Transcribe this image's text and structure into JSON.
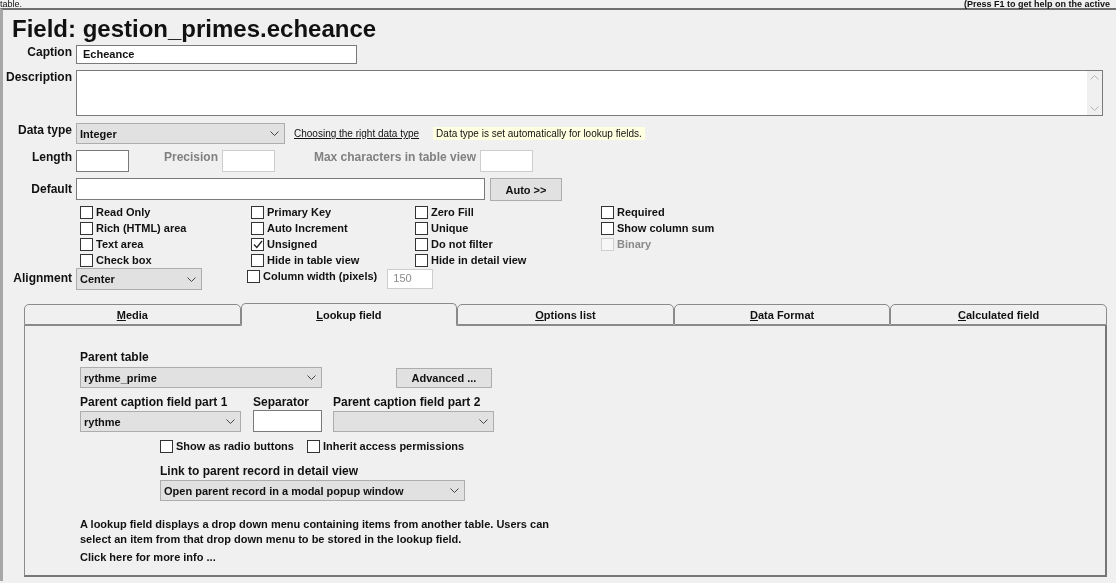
{
  "top_bar": {
    "left_text": "table.",
    "right_text": "(Press F1 to get help on the active"
  },
  "title": "Field: gestion_primes.echeance",
  "caption": {
    "label": "Caption",
    "value": "Echeance"
  },
  "description": {
    "label": "Description"
  },
  "data_type": {
    "label": "Data type",
    "value": "Integer",
    "link": "Choosing the right data type",
    "note": "Data type is set automatically for lookup fields."
  },
  "length": {
    "label": "Length"
  },
  "precision": {
    "label": "Precision",
    "disabled": true
  },
  "max_characters": {
    "label": "Max characters in table view",
    "disabled": true
  },
  "default": {
    "label": "Default",
    "button": "Auto >>"
  },
  "checkbox_columns": [
    [
      {
        "label": "Read Only",
        "checked": false,
        "disabled": false
      },
      {
        "label": "Rich (HTML) area",
        "checked": false,
        "disabled": false
      },
      {
        "label": "Text area",
        "checked": false,
        "disabled": false
      },
      {
        "label": "Check box",
        "checked": false,
        "disabled": false
      }
    ],
    [
      {
        "label": "Primary Key",
        "checked": false,
        "disabled": false
      },
      {
        "label": "Auto Increment",
        "checked": false,
        "disabled": false
      },
      {
        "label": "Unsigned",
        "checked": true,
        "disabled": false
      },
      {
        "label": "Hide in table view",
        "checked": false,
        "disabled": false
      }
    ],
    [
      {
        "label": "Zero Fill",
        "checked": false,
        "disabled": false
      },
      {
        "label": "Unique",
        "checked": false,
        "disabled": false
      },
      {
        "label": "Do not filter",
        "checked": false,
        "disabled": false
      },
      {
        "label": "Hide in detail view",
        "checked": false,
        "disabled": false
      }
    ],
    [
      {
        "label": "Required",
        "checked": false,
        "disabled": false
      },
      {
        "label": "Show column sum",
        "checked": false,
        "disabled": false
      },
      {
        "label": "Binary",
        "checked": false,
        "disabled": true
      }
    ]
  ],
  "alignment": {
    "label": "Alignment",
    "value": "Center"
  },
  "column_width": {
    "label": "Column width (pixels)",
    "checked": false,
    "disabled": false,
    "value": "150",
    "value_disabled": true
  },
  "tabs": [
    {
      "label": "Media",
      "selected": false
    },
    {
      "label": "Lookup field",
      "selected": true
    },
    {
      "label": "Options list",
      "selected": false
    },
    {
      "label": "Data Format",
      "selected": false
    },
    {
      "label": "Calculated field",
      "selected": false
    }
  ],
  "lookup": {
    "parent_table": {
      "label": "Parent table",
      "value": "rythme_prime"
    },
    "advanced_button": "Advanced ...",
    "caption_part_1": {
      "label": "Parent caption field part 1",
      "value": "rythme"
    },
    "separator": {
      "label": "Separator"
    },
    "caption_part_2": {
      "label": "Parent caption field part 2"
    },
    "options": [
      {
        "label": "Show as radio buttons",
        "checked": false,
        "disabled": false
      },
      {
        "label": "Inherit access permissions",
        "checked": false,
        "disabled": false
      }
    ],
    "link_to_parent": {
      "label": "Link to parent record in detail view",
      "value": "Open parent record in a modal popup window"
    },
    "info": "A lookup field displays a drop down menu containing items from another table. Users can select an item from that drop down menu to be stored in the lookup field.",
    "more_info_link": "Click here for more info ..."
  }
}
